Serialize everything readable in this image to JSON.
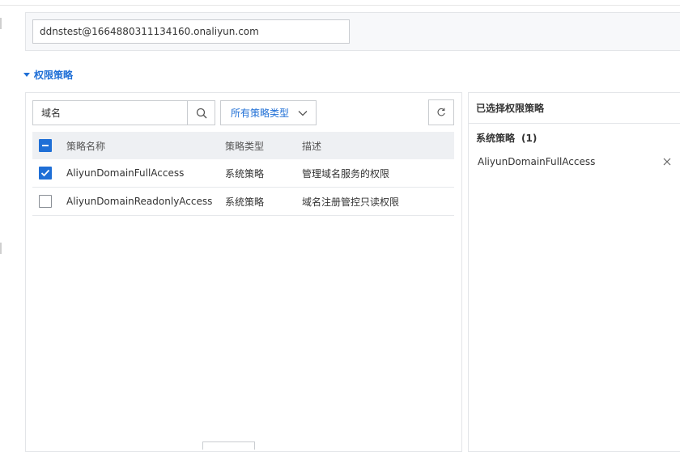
{
  "principal": {
    "value": "ddnstest@1664880311134160.onaliyun.com"
  },
  "policy_section": {
    "title": "权限策略"
  },
  "search": {
    "value": "域名"
  },
  "type_filter": {
    "label": "所有策略类型"
  },
  "table": {
    "headers": {
      "name": "策略名称",
      "type": "策略类型",
      "desc": "描述"
    },
    "rows": [
      {
        "name": "AliyunDomainFullAccess",
        "type": "系统策略",
        "desc": "管理域名服务的权限",
        "checked": true
      },
      {
        "name": "AliyunDomainReadonlyAccess",
        "type": "系统策略",
        "desc": "域名注册管控只读权限",
        "checked": false
      }
    ]
  },
  "selected_panel": {
    "title": "已选择权限策略",
    "group_label": "系统策略",
    "group_count": "(1)",
    "items": [
      {
        "name": "AliyunDomainFullAccess"
      }
    ]
  },
  "colors": {
    "accent": "#1f6fd6",
    "header_bg": "#eef0f3",
    "border": "#e3e5e8"
  },
  "icons": {
    "search": "search-icon",
    "dropdown": "chevron-down-icon",
    "refresh": "refresh-icon",
    "remove": "close-icon"
  }
}
